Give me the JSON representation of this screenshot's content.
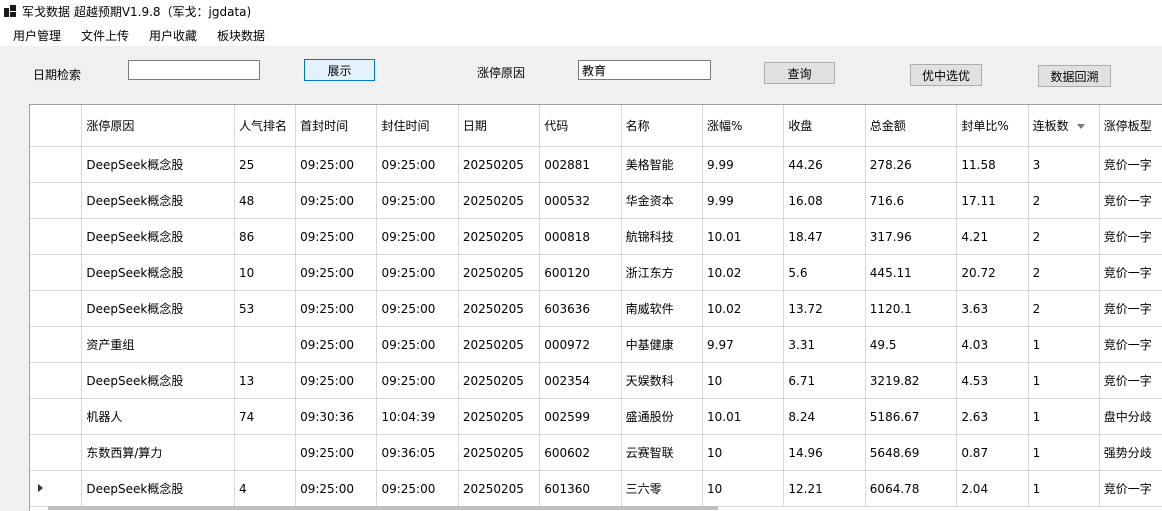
{
  "window": {
    "title": "军戈数据 超越预期V1.9.8（军戈：jgdata)"
  },
  "menu": [
    "用户管理",
    "文件上传",
    "用户收藏",
    "板块数据"
  ],
  "toolbar": {
    "date_label": "日期检索",
    "date_value": "",
    "show_button": "展示",
    "reason_label": "涨停原因",
    "reason_value": "教育",
    "query_button": "查询",
    "select_button": "优中选优",
    "backtest_button": "数据回溯"
  },
  "table": {
    "columns": [
      "涨停原因",
      "人气排名",
      "首封时间",
      "封住时间",
      "日期",
      "代码",
      "名称",
      "涨幅%",
      "收盘",
      "总金额",
      "封单比%",
      "连板数",
      "涨停板型"
    ],
    "rows": [
      [
        "DeepSeek概念股",
        "25",
        "09:25:00",
        "09:25:00",
        "20250205",
        "002881",
        "美格智能",
        "9.99",
        "44.26",
        "278.26",
        "11.58",
        "3",
        "竞价一字"
      ],
      [
        "DeepSeek概念股",
        "48",
        "09:25:00",
        "09:25:00",
        "20250205",
        "000532",
        "华金资本",
        "9.99",
        "16.08",
        "716.6",
        "17.11",
        "2",
        "竞价一字"
      ],
      [
        "DeepSeek概念股",
        "86",
        "09:25:00",
        "09:25:00",
        "20250205",
        "000818",
        "航锦科技",
        "10.01",
        "18.47",
        "317.96",
        "4.21",
        "2",
        "竞价一字"
      ],
      [
        "DeepSeek概念股",
        "10",
        "09:25:00",
        "09:25:00",
        "20250205",
        "600120",
        "浙江东方",
        "10.02",
        "5.6",
        "445.11",
        "20.72",
        "2",
        "竞价一字"
      ],
      [
        "DeepSeek概念股",
        "53",
        "09:25:00",
        "09:25:00",
        "20250205",
        "603636",
        "南威软件",
        "10.02",
        "13.72",
        "1120.1",
        "3.63",
        "2",
        "竞价一字"
      ],
      [
        "资产重组",
        "",
        "09:25:00",
        "09:25:00",
        "20250205",
        "000972",
        "中基健康",
        "9.97",
        "3.31",
        "49.5",
        "4.03",
        "1",
        "竞价一字"
      ],
      [
        "DeepSeek概念股",
        "13",
        "09:25:00",
        "09:25:00",
        "20250205",
        "002354",
        "天娱数科",
        "10",
        "6.71",
        "3219.82",
        "4.53",
        "1",
        "竞价一字"
      ],
      [
        "机器人",
        "74",
        "09:30:36",
        "10:04:39",
        "20250205",
        "002599",
        "盛通股份",
        "10.01",
        "8.24",
        "5186.67",
        "2.63",
        "1",
        "盘中分歧"
      ],
      [
        "东数西算/算力",
        "",
        "09:25:00",
        "09:36:05",
        "20250205",
        "600602",
        "云赛智联",
        "10",
        "14.96",
        "5648.69",
        "0.87",
        "1",
        "强势分歧"
      ],
      [
        "DeepSeek概念股",
        "4",
        "09:25:00",
        "09:25:00",
        "20250205",
        "601360",
        "三六零",
        "10",
        "12.21",
        "6064.78",
        "2.04",
        "1",
        "竞价一字"
      ]
    ],
    "current_row": 9,
    "sorted_column": "连板数"
  }
}
